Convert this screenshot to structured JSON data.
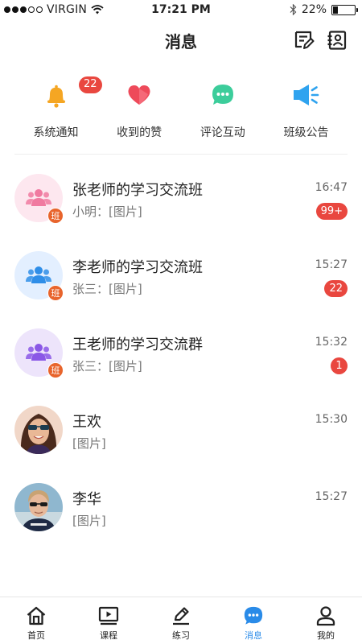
{
  "status_bar": {
    "carrier": "VIRGIN",
    "time": "17:21 PM",
    "battery": "22%",
    "battery_level": 0.22
  },
  "header": {
    "title": "消息"
  },
  "quick_actions": [
    {
      "label": "系统通知",
      "icon": "bell-icon",
      "color": "#f5a623",
      "badge": "22"
    },
    {
      "label": "收到的赞",
      "icon": "heart-icon",
      "color": "#ee4a5a"
    },
    {
      "label": "评论互动",
      "icon": "comment-icon",
      "color": "#3ccd9b"
    },
    {
      "label": "班级公告",
      "icon": "megaphone-icon",
      "color": "#2fa3ef"
    }
  ],
  "chats": [
    {
      "name": "张老师的学习交流班",
      "preview": "小明：[图片]",
      "time": "16:47",
      "badge": "99+",
      "tag": "班",
      "avatar_color": "#f07aa0"
    },
    {
      "name": "李老师的学习交流班",
      "preview": "张三：[图片]",
      "time": "15:27",
      "badge": "22",
      "tag": "班",
      "avatar_color": "#2f8ee8"
    },
    {
      "name": "王老师的学习交流群",
      "preview": "张三：[图片]",
      "time": "15:32",
      "badge": "1",
      "tag": "班",
      "avatar_color": "#8a57e6"
    },
    {
      "name": "王欢",
      "preview": "[图片]",
      "time": "15:30"
    },
    {
      "name": "李华",
      "preview": "[图片]",
      "time": "15:27"
    }
  ],
  "tabs": [
    {
      "label": "首页",
      "icon": "home-icon"
    },
    {
      "label": "课程",
      "icon": "course-play-icon"
    },
    {
      "label": "练习",
      "icon": "pencil-icon"
    },
    {
      "label": "消息",
      "icon": "message-bubble-icon",
      "active": true
    },
    {
      "label": "我的",
      "icon": "person-icon"
    }
  ],
  "colors": {
    "accent": "#2a8be8",
    "badge": "#e9473f",
    "tag": "#e8642c"
  }
}
